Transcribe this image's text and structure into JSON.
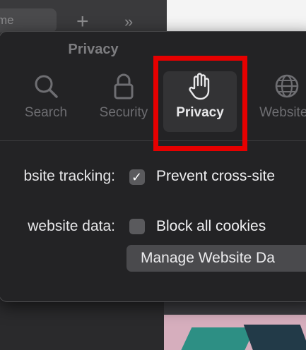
{
  "background": {
    "tab_label": "me",
    "new_tab_symbol": "+",
    "overflow_symbol": "»"
  },
  "panel": {
    "title": "Privacy"
  },
  "toolbar": {
    "items": [
      {
        "label": "Search",
        "icon": "magnifier-icon"
      },
      {
        "label": "Security",
        "icon": "lock-icon"
      },
      {
        "label": "Privacy",
        "icon": "hand-icon",
        "selected": true
      },
      {
        "label": "Websites",
        "icon": "globe-icon"
      }
    ]
  },
  "settings": {
    "tracking_label": "bsite tracking:",
    "tracking_option": "Prevent cross-site",
    "tracking_checked": true,
    "data_label": "website data:",
    "cookies_option": "Block all cookies",
    "cookies_checked": false,
    "manage_button": "Manage Website Da"
  },
  "colors": {
    "highlight": "#e60000",
    "panel_bg": "#232325"
  }
}
